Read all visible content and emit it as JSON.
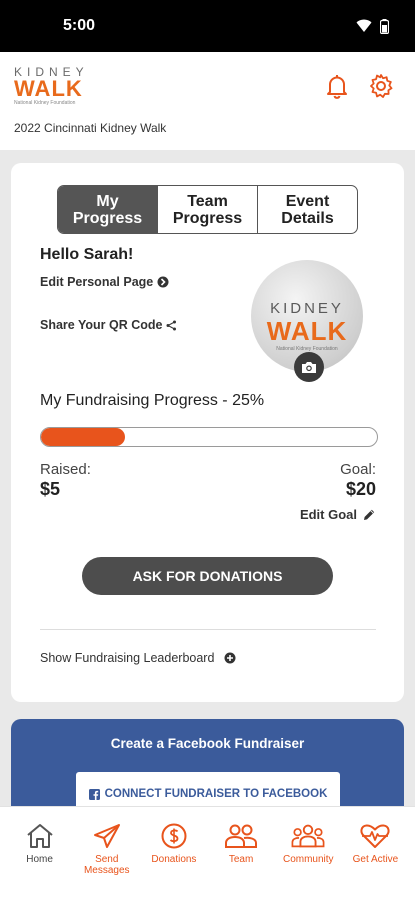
{
  "status_bar": {
    "time": "5:00"
  },
  "header": {
    "logo": {
      "line1": "KIDNEY",
      "line2": "WALK",
      "line3": "National Kidney Foundation"
    },
    "event_title": "2022 Cincinnati Kidney Walk"
  },
  "tabs": [
    {
      "label": "My Progress"
    },
    {
      "label": "Team Progress"
    },
    {
      "label": "Event Details"
    }
  ],
  "profile": {
    "greeting": "Hello Sarah!",
    "edit_page": "Edit Personal Page",
    "share_qr": "Share Your QR Code",
    "avatar": {
      "line1": "KIDNEY",
      "line2": "WALK",
      "line3": "National Kidney Foundation"
    }
  },
  "fundraising": {
    "title": "My Fundraising Progress - 25%",
    "progress_fraction": 0.25,
    "raised_label": "Raised:",
    "raised_value": "$5",
    "goal_label": "Goal:",
    "goal_value": "$20",
    "edit_goal": "Edit Goal"
  },
  "ask_button": "ASK FOR DONATIONS",
  "leaderboard_link": "Show Fundraising Leaderboard",
  "facebook": {
    "title": "Create a Facebook Fundraiser",
    "button": "CONNECT FUNDRAISER TO FACEBOOK"
  },
  "nav": [
    {
      "label": "Home",
      "icon": "home-icon"
    },
    {
      "label": "Send Messages",
      "icon": "send-icon"
    },
    {
      "label": "Donations",
      "icon": "dollar-icon"
    },
    {
      "label": "Team",
      "icon": "team-icon"
    },
    {
      "label": "Community",
      "icon": "community-icon"
    },
    {
      "label": "Get Active",
      "icon": "heart-pulse-icon"
    }
  ],
  "colors": {
    "accent": "#e8541c",
    "dark": "#4d4d4d",
    "facebook": "#3b5b9b"
  }
}
